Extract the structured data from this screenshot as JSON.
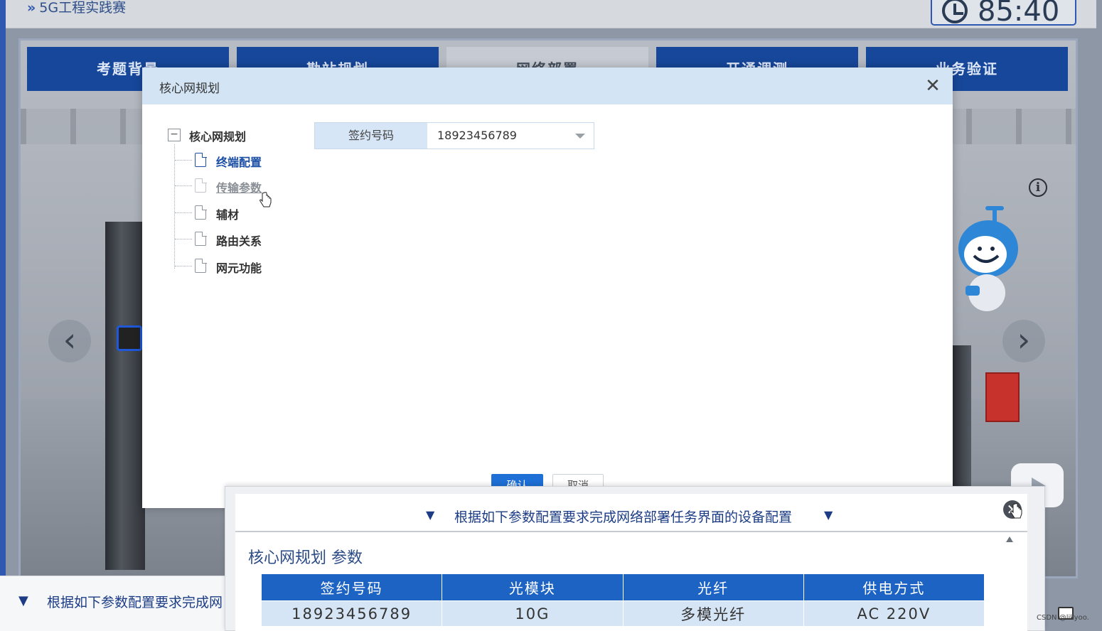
{
  "app": {
    "title": "5G工程实践赛",
    "timer": "85:40",
    "info_icon": "info-icon",
    "tabs": [
      {
        "label": "考题背景",
        "active": false
      },
      {
        "label": "勘站规划",
        "active": false
      },
      {
        "label": "网络部署",
        "active": true
      },
      {
        "label": "开通调测",
        "active": false
      },
      {
        "label": "业务验证",
        "active": false
      }
    ]
  },
  "dialog": {
    "title": "核心网规划",
    "tree": {
      "root_label": "核心网规划",
      "items": [
        {
          "label": "终端配置",
          "state": "selected"
        },
        {
          "label": "传输参数",
          "state": "hover"
        },
        {
          "label": "辅材",
          "state": "normal"
        },
        {
          "label": "路由关系",
          "state": "normal"
        },
        {
          "label": "网元功能",
          "state": "normal"
        }
      ]
    },
    "form": {
      "field_label": "签约号码",
      "field_value": "18923456789"
    },
    "confirm_label": "确认",
    "cancel_label": "取消"
  },
  "param_panel": {
    "instruction": "根据如下参数配置要求完成网络部署任务界面的设备配置",
    "section_title": "核心网规划 参数",
    "table": {
      "headers": [
        "签约号码",
        "光模块",
        "光纤",
        "供电方式"
      ],
      "rows": [
        [
          "18923456789",
          "10G",
          "多模光纤",
          "AC 220V"
        ]
      ]
    }
  },
  "bottom_strip": {
    "text": "根据如下参数配置要求完成网"
  },
  "watermark": "CSDN @likyoo.",
  "colors": {
    "tab_blue": "#17479a",
    "header_light_blue": "#d3e5f5",
    "table_header_blue": "#1c63c4",
    "confirm_blue": "#1e6fd6"
  }
}
